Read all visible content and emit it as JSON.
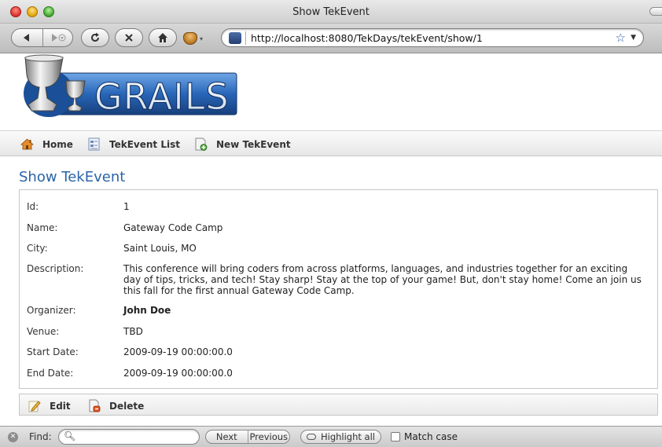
{
  "window": {
    "title": "Show TekEvent"
  },
  "navigation": {
    "url": "http://localhost:8080/TekDays/tekEvent/show/1",
    "icons": {
      "back": "back-arrow-icon",
      "forward": "forward-arrow-icon",
      "reload": "reload-icon",
      "stop": "stop-icon",
      "home": "home-icon",
      "bookmark": "star-icon"
    }
  },
  "logo": {
    "text": "GRAILS"
  },
  "menu": {
    "home": "Home",
    "list": "TekEvent List",
    "new": "New TekEvent"
  },
  "page": {
    "title": "Show TekEvent"
  },
  "event": {
    "rows": [
      {
        "label": "Id:",
        "value": "1"
      },
      {
        "label": "Name:",
        "value": "Gateway Code Camp"
      },
      {
        "label": "City:",
        "value": "Saint Louis, MO"
      },
      {
        "label": "Description:",
        "value": "This conference will bring coders from across platforms, languages, and industries together for an exciting day of tips, tricks, and tech! Stay sharp! Stay at the top of your game! But, don't stay home! Come an join us this fall for the first annual Gateway Code Camp."
      },
      {
        "label": "Organizer:",
        "value": "John Doe"
      },
      {
        "label": "Venue:",
        "value": "TBD"
      },
      {
        "label": "Start Date:",
        "value": "2009-09-19 00:00:00.0"
      },
      {
        "label": "End Date:",
        "value": "2009-09-19 00:00:00.0"
      }
    ]
  },
  "actions": {
    "edit": "Edit",
    "delete": "Delete"
  },
  "findbar": {
    "label": "Find:",
    "input_value": "",
    "next": "Next",
    "previous": "Previous",
    "highlight": "Highlight all",
    "match_case": "Match case",
    "match_case_checked": false
  },
  "colors": {
    "title_blue": "#2a64a8",
    "logo_blue": "#1f5aa8"
  }
}
